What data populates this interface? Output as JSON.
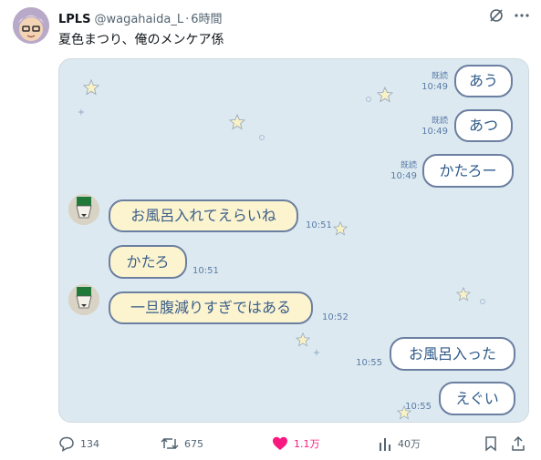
{
  "post": {
    "display_name": "LPLS",
    "handle": "@wagahaida_L",
    "separator": "·",
    "time": "6時間",
    "text": "夏色まつり、俺のメンケア係"
  },
  "chat": {
    "right_messages": [
      {
        "text": "あう",
        "read": "既読",
        "time": "10:49"
      },
      {
        "text": "あつ",
        "read": "既読",
        "time": "10:49"
      },
      {
        "text": "かたろー",
        "read": "既読",
        "time": "10:49"
      },
      {
        "text": "お風呂入った",
        "read": "",
        "time": "10:55"
      },
      {
        "text": "えぐい",
        "read": "",
        "time": "10:55"
      }
    ],
    "left_messages": [
      {
        "text": "お風呂入れてえらいね",
        "time": "10:51"
      },
      {
        "text": "かたろ",
        "time": "10:51"
      },
      {
        "text": "一旦腹減りすぎではある",
        "time": "10:52"
      }
    ]
  },
  "actions": {
    "replies": "134",
    "reposts": "675",
    "likes": "1.1万",
    "views": "40万"
  },
  "colors": {
    "like": "#f91880",
    "chat_background": "#dde9f1",
    "bubble_border": "#6b7fa0",
    "left_bubble": "#fcf4cf"
  }
}
